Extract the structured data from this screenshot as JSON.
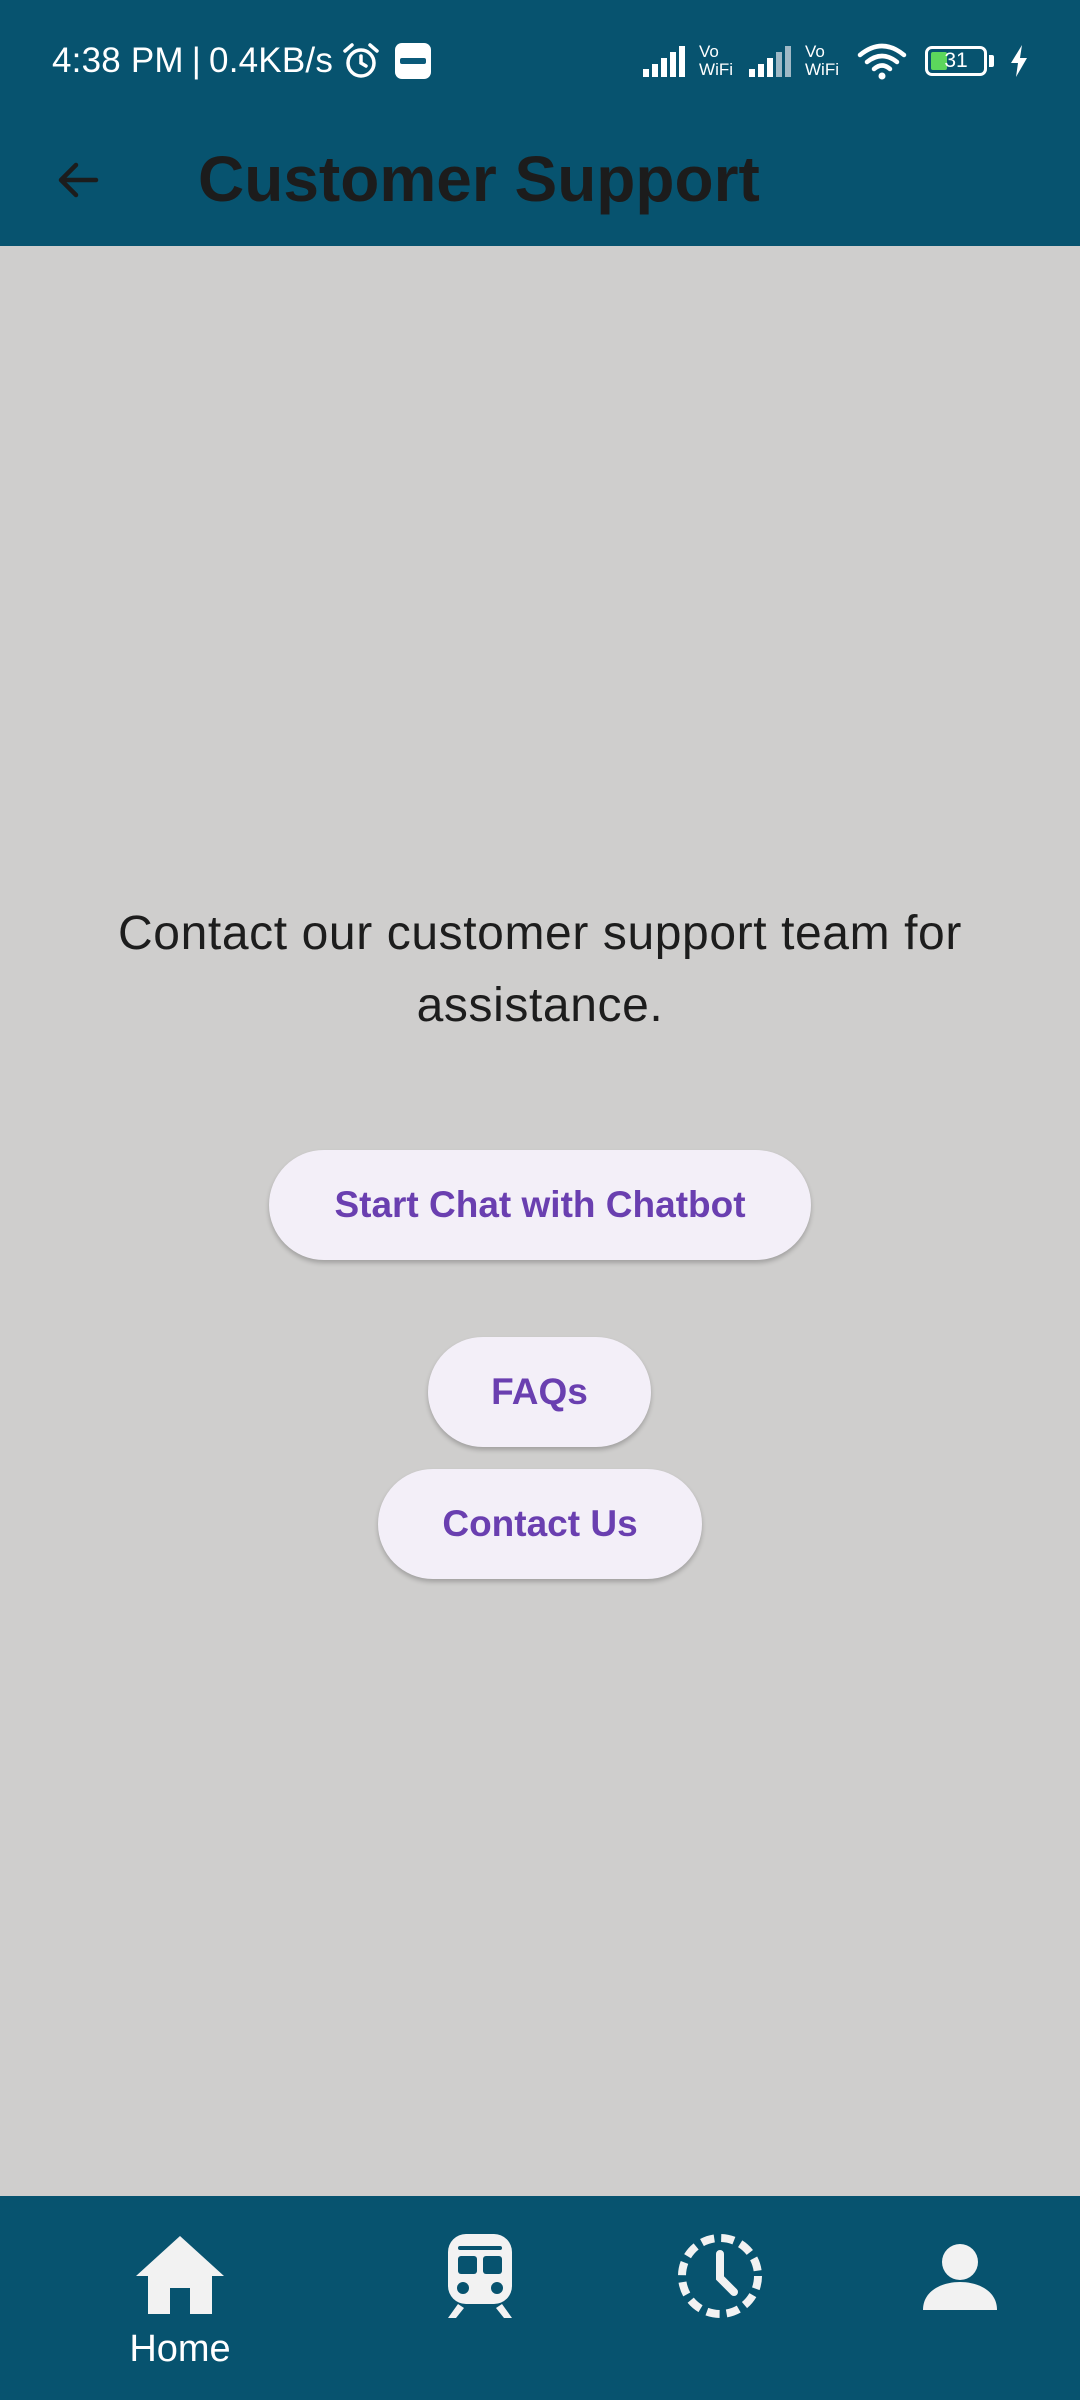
{
  "status_bar": {
    "time": "4:38 PM",
    "separator": "|",
    "network_speed": "0.4KB/s",
    "vowifi_top": "Vo",
    "vowifi_bottom": "WiFi",
    "battery_level": "31",
    "battery_fraction": 0.31,
    "battery_fill_color": "#5cd65c"
  },
  "app_bar": {
    "title": "Customer Support",
    "back_icon": "arrow-back-icon"
  },
  "main": {
    "description": "Contact our customer support team for assistance.",
    "buttons": [
      {
        "label": "Start Chat with Chatbot"
      },
      {
        "label": "FAQs"
      },
      {
        "label": "Contact Us"
      }
    ]
  },
  "bottom_nav": {
    "items": [
      {
        "label": "Home",
        "icon": "home-icon"
      },
      {
        "label": "",
        "icon": "train-icon"
      },
      {
        "label": "",
        "icon": "history-icon"
      },
      {
        "label": "",
        "icon": "person-icon"
      }
    ]
  },
  "colors": {
    "primary": "#07536f",
    "background": "#cfcecd",
    "button_bg": "#f3eff8",
    "button_text": "#6a3fb0",
    "title_text": "#1c1c1c"
  }
}
